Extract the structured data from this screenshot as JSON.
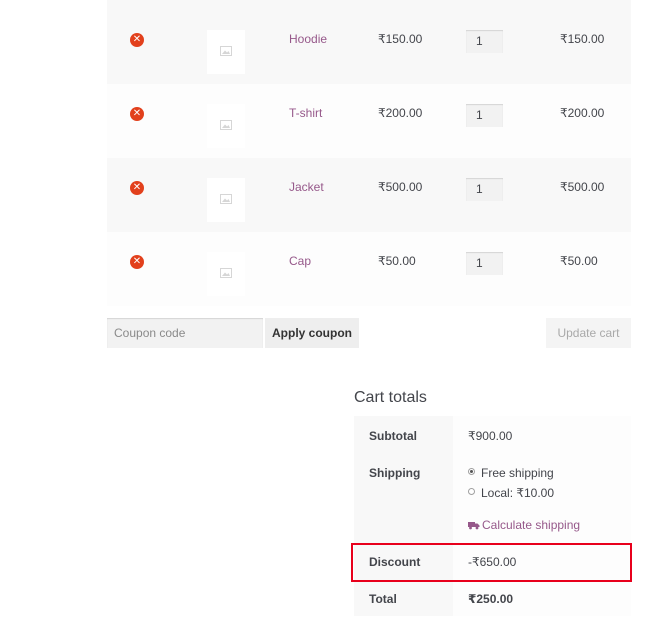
{
  "cart": {
    "items": [
      {
        "name": "Hoodie",
        "price": "₹150.00",
        "qty": "1",
        "subtotal": "₹150.00"
      },
      {
        "name": "T-shirt",
        "price": "₹200.00",
        "qty": "1",
        "subtotal": "₹200.00"
      },
      {
        "name": "Jacket",
        "price": "₹500.00",
        "qty": "1",
        "subtotal": "₹500.00"
      },
      {
        "name": "Cap",
        "price": "₹50.00",
        "qty": "1",
        "subtotal": "₹50.00"
      }
    ],
    "remove_symbol": "✕",
    "coupon_placeholder": "Coupon code",
    "apply_coupon_label": "Apply coupon",
    "update_cart_label": "Update cart"
  },
  "totals": {
    "title": "Cart totals",
    "subtotal_label": "Subtotal",
    "subtotal_value": "₹900.00",
    "shipping_label": "Shipping",
    "shipping_options": [
      {
        "label": "Free shipping",
        "selected": true
      },
      {
        "label": "Local: ₹10.00",
        "selected": false
      }
    ],
    "calculate_shipping_label": "Calculate shipping",
    "discount_label": "Discount",
    "discount_value": "-₹650.00",
    "total_label": "Total",
    "total_value": "₹250.00"
  },
  "colors": {
    "accent": "#96588a",
    "remove": "#e2401c",
    "highlight": "#e8001c"
  }
}
